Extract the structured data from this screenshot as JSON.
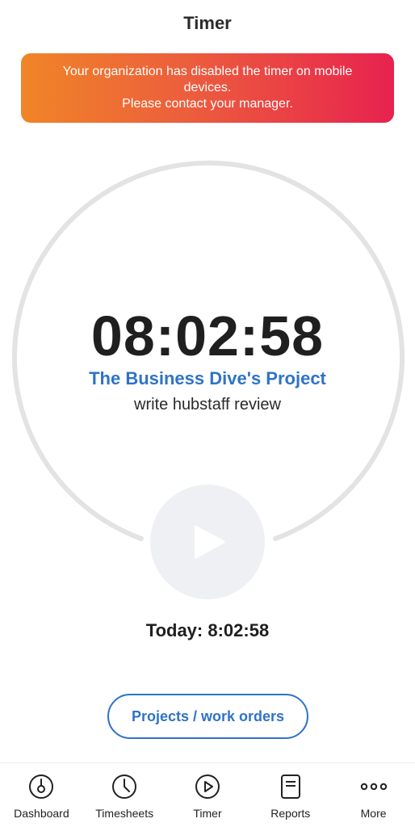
{
  "header": {
    "title": "Timer"
  },
  "alert": {
    "line1": "Your organization has disabled the timer on mobile devices.",
    "line2": "Please contact your manager."
  },
  "timer": {
    "elapsed": "08:02:58",
    "project": "The Business Dive's Project",
    "task": "write hubstaff review"
  },
  "today": {
    "label": "Today:",
    "value": "8:02:58"
  },
  "projects_button": {
    "label": "Projects / work orders"
  },
  "nav": {
    "items": [
      {
        "label": "Dashboard",
        "icon": "dashboard-icon"
      },
      {
        "label": "Timesheets",
        "icon": "clock-icon"
      },
      {
        "label": "Timer",
        "icon": "play-circle-icon"
      },
      {
        "label": "Reports",
        "icon": "reports-icon"
      },
      {
        "label": "More",
        "icon": "more-icon"
      }
    ]
  },
  "colors": {
    "accent": "#2f73c8",
    "alert_start": "#f08527",
    "alert_end": "#e7224e",
    "ring": "#e3e3e3"
  }
}
